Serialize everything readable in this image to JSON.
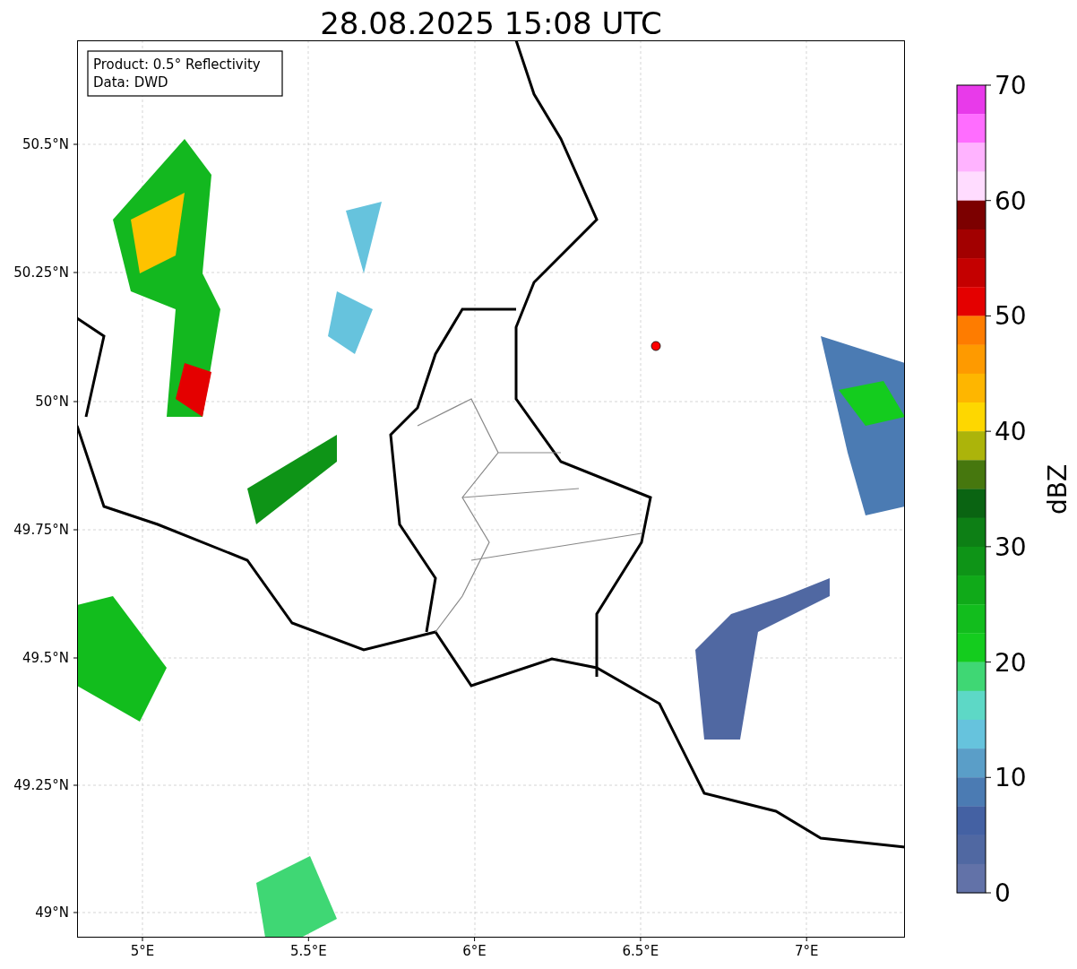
{
  "title": "28.08.2025 15:08 UTC",
  "map": {
    "info_box": [
      "Product: 0.5° Reflectivity",
      "Data: DWD"
    ],
    "y_ticks": [
      "50.5°N",
      "50.25°N",
      "50°N",
      "49.75°N",
      "49.5°N",
      "49.25°N",
      "49°N"
    ],
    "x_ticks": [
      "5°E",
      "5.5°E",
      "6°E",
      "6.5°E",
      "7°E"
    ]
  },
  "colorbar": {
    "label": "dBZ",
    "ticks": [
      "70",
      "60",
      "50",
      "40",
      "30",
      "20",
      "10",
      "0"
    ],
    "segments": [
      {
        "color": "#e83aea"
      },
      {
        "color": "#ff6dff"
      },
      {
        "color": "#ffb3ff"
      },
      {
        "color": "#ffdcff"
      },
      {
        "color": "#7c0000"
      },
      {
        "color": "#a20000"
      },
      {
        "color": "#c40000"
      },
      {
        "color": "#e40000"
      },
      {
        "color": "#fe7c00"
      },
      {
        "color": "#fe9a00"
      },
      {
        "color": "#feb600"
      },
      {
        "color": "#fed700"
      },
      {
        "color": "#acb40a"
      },
      {
        "color": "#46770e"
      },
      {
        "color": "#0a6412"
      },
      {
        "color": "#0d7f15"
      },
      {
        "color": "#0e9417"
      },
      {
        "color": "#10aa19"
      },
      {
        "color": "#12bd1d"
      },
      {
        "color": "#14cc1e"
      },
      {
        "color": "#3fd774"
      },
      {
        "color": "#5dd8c6"
      },
      {
        "color": "#66c3dd"
      },
      {
        "color": "#5a9ec8"
      },
      {
        "color": "#4b7bb3"
      },
      {
        "color": "#4461a3"
      },
      {
        "color": "#5068a2"
      },
      {
        "color": "#6272a8"
      }
    ]
  }
}
